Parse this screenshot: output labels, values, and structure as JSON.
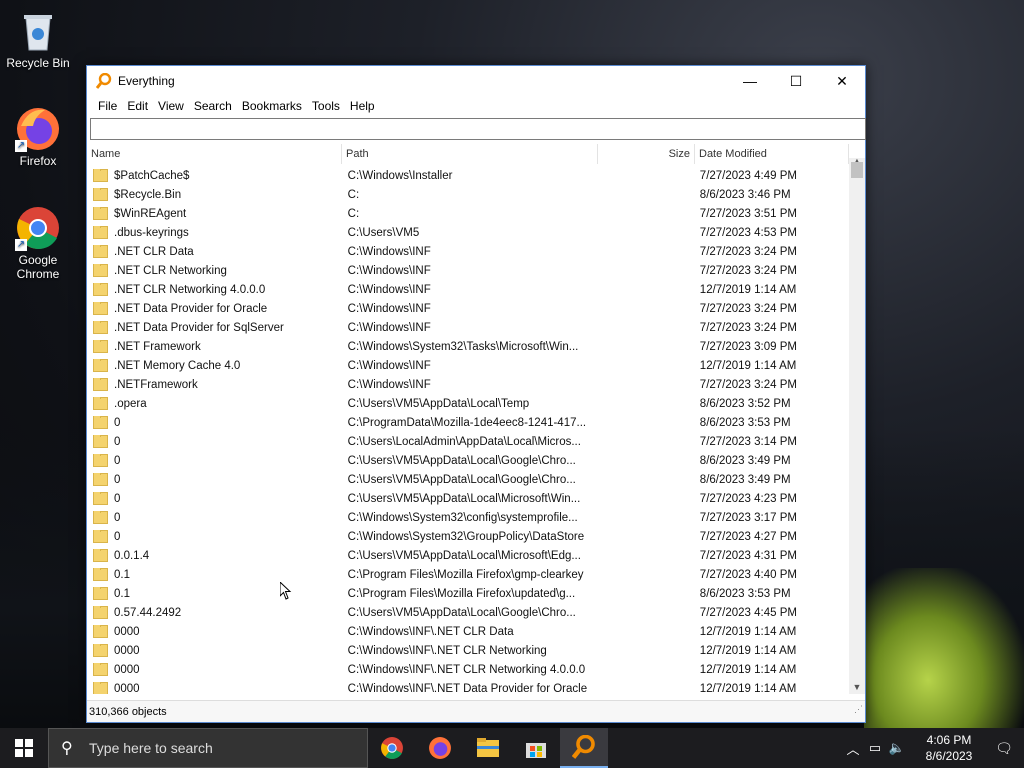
{
  "desktop": {
    "icons": [
      {
        "label": "Recycle Bin"
      },
      {
        "label": "Firefox"
      },
      {
        "label": "Google Chrome"
      }
    ]
  },
  "window": {
    "title": "Everything",
    "controls": {
      "minimize": "—",
      "maximize": "☐",
      "close": "✕"
    },
    "menu": [
      "File",
      "Edit",
      "View",
      "Search",
      "Bookmarks",
      "Tools",
      "Help"
    ],
    "search": {
      "value": "",
      "placeholder": ""
    },
    "columns": {
      "name": "Name",
      "path": "Path",
      "size": "Size",
      "date": "Date Modified"
    },
    "rows": [
      {
        "name": "$PatchCache$",
        "path": "C:\\Windows\\Installer",
        "date": "7/27/2023 4:49 PM"
      },
      {
        "name": "$Recycle.Bin",
        "path": "C:",
        "date": "8/6/2023 3:46 PM"
      },
      {
        "name": "$WinREAgent",
        "path": "C:",
        "date": "7/27/2023 3:51 PM"
      },
      {
        "name": ".dbus-keyrings",
        "path": "C:\\Users\\VM5",
        "date": "7/27/2023 4:53 PM"
      },
      {
        "name": ".NET CLR Data",
        "path": "C:\\Windows\\INF",
        "date": "7/27/2023 3:24 PM"
      },
      {
        "name": ".NET CLR Networking",
        "path": "C:\\Windows\\INF",
        "date": "7/27/2023 3:24 PM"
      },
      {
        "name": ".NET CLR Networking 4.0.0.0",
        "path": "C:\\Windows\\INF",
        "date": "12/7/2019 1:14 AM"
      },
      {
        "name": ".NET Data Provider for Oracle",
        "path": "C:\\Windows\\INF",
        "date": "7/27/2023 3:24 PM"
      },
      {
        "name": ".NET Data Provider for SqlServer",
        "path": "C:\\Windows\\INF",
        "date": "7/27/2023 3:24 PM"
      },
      {
        "name": ".NET Framework",
        "path": "C:\\Windows\\System32\\Tasks\\Microsoft\\Win...",
        "date": "7/27/2023 3:09 PM"
      },
      {
        "name": ".NET Memory Cache 4.0",
        "path": "C:\\Windows\\INF",
        "date": "12/7/2019 1:14 AM"
      },
      {
        "name": ".NETFramework",
        "path": "C:\\Windows\\INF",
        "date": "7/27/2023 3:24 PM"
      },
      {
        "name": ".opera",
        "path": "C:\\Users\\VM5\\AppData\\Local\\Temp",
        "date": "8/6/2023 3:52 PM"
      },
      {
        "name": "0",
        "path": "C:\\ProgramData\\Mozilla-1de4eec8-1241-417...",
        "date": "8/6/2023 3:53 PM"
      },
      {
        "name": "0",
        "path": "C:\\Users\\LocalAdmin\\AppData\\Local\\Micros...",
        "date": "7/27/2023 3:14 PM"
      },
      {
        "name": "0",
        "path": "C:\\Users\\VM5\\AppData\\Local\\Google\\Chro...",
        "date": "8/6/2023 3:49 PM"
      },
      {
        "name": "0",
        "path": "C:\\Users\\VM5\\AppData\\Local\\Google\\Chro...",
        "date": "8/6/2023 3:49 PM"
      },
      {
        "name": "0",
        "path": "C:\\Users\\VM5\\AppData\\Local\\Microsoft\\Win...",
        "date": "7/27/2023 4:23 PM"
      },
      {
        "name": "0",
        "path": "C:\\Windows\\System32\\config\\systemprofile...",
        "date": "7/27/2023 3:17 PM"
      },
      {
        "name": "0",
        "path": "C:\\Windows\\System32\\GroupPolicy\\DataStore",
        "date": "7/27/2023 4:27 PM"
      },
      {
        "name": "0.0.1.4",
        "path": "C:\\Users\\VM5\\AppData\\Local\\Microsoft\\Edg...",
        "date": "7/27/2023 4:31 PM"
      },
      {
        "name": "0.1",
        "path": "C:\\Program Files\\Mozilla Firefox\\gmp-clearkey",
        "date": "7/27/2023 4:40 PM"
      },
      {
        "name": "0.1",
        "path": "C:\\Program Files\\Mozilla Firefox\\updated\\g...",
        "date": "8/6/2023 3:53 PM"
      },
      {
        "name": "0.57.44.2492",
        "path": "C:\\Users\\VM5\\AppData\\Local\\Google\\Chro...",
        "date": "7/27/2023 4:45 PM"
      },
      {
        "name": "0000",
        "path": "C:\\Windows\\INF\\.NET CLR Data",
        "date": "12/7/2019 1:14 AM"
      },
      {
        "name": "0000",
        "path": "C:\\Windows\\INF\\.NET CLR Networking",
        "date": "12/7/2019 1:14 AM"
      },
      {
        "name": "0000",
        "path": "C:\\Windows\\INF\\.NET CLR Networking 4.0.0.0",
        "date": "12/7/2019 1:14 AM"
      },
      {
        "name": "0000",
        "path": "C:\\Windows\\INF\\.NET Data Provider for Oracle",
        "date": "12/7/2019 1:14 AM"
      }
    ],
    "status": "310,366 objects"
  },
  "taskbar": {
    "search_placeholder": "Type here to search",
    "apps": [
      "chrome-icon",
      "firefox-icon",
      "file-explorer-icon",
      "store-icon",
      "everything-icon"
    ],
    "time": "4:06 PM",
    "date": "8/6/2023"
  },
  "colors": {
    "accent": "#79b0f0",
    "folder": "#f4d36e",
    "taskbar": "#1c1c1f"
  }
}
